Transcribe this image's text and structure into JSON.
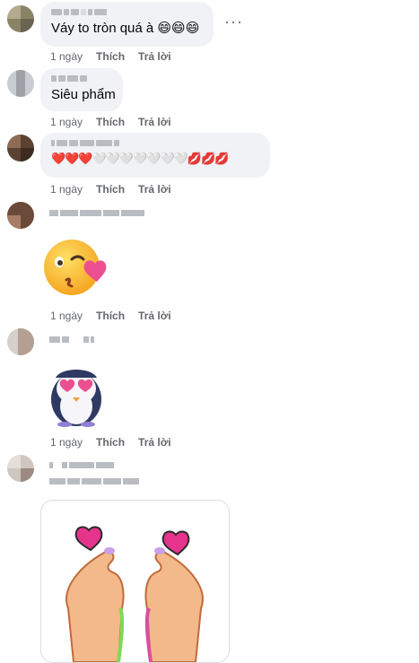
{
  "comments": [
    {
      "text": "Váy to tròn quá à",
      "emoji_text": "😄😄😄",
      "time": "1 ngày",
      "like": "Thích",
      "reply": "Trả lời",
      "more": "···"
    },
    {
      "text": "Siêu phẩm",
      "time": "1 ngày",
      "like": "Thích",
      "reply": "Trả lời"
    },
    {
      "reactions": "❤️❤️❤️🤍🤍🤍🤍🤍🤍🤍💋💋💋",
      "time": "1 ngày",
      "like": "Thích",
      "reply": "Trả lời"
    },
    {
      "sticker": "kissing-heart-emoji-sticker",
      "time": "1 ngày",
      "like": "Thích",
      "reply": "Trả lời"
    },
    {
      "sticker": "penguin-heart-eyes-sticker",
      "time": "1 ngày",
      "like": "Thích",
      "reply": "Trả lời"
    },
    {
      "sticker": "finger-hearts-sticker"
    }
  ],
  "colors": {
    "bubble": "#f0f2f5",
    "meta_text": "#65676b",
    "heart_red": "#e0245e",
    "heart_pink": "#ec4f8f"
  }
}
